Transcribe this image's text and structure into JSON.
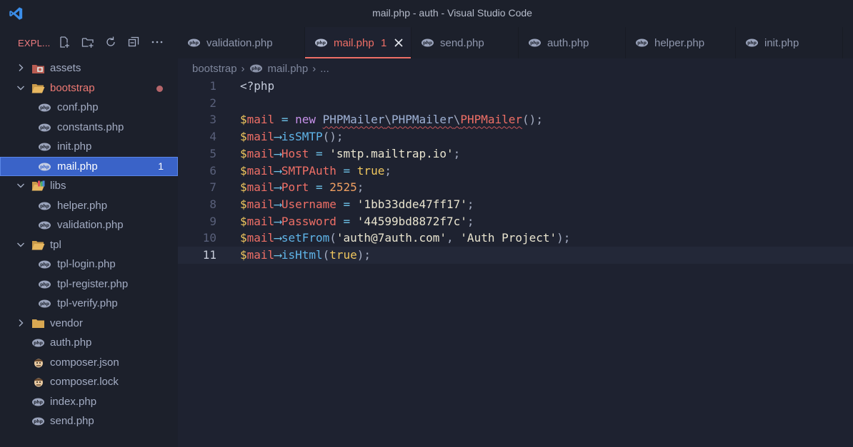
{
  "window": {
    "title": "mail.php - auth - Visual Studio Code"
  },
  "sidebar": {
    "title": "EXPL...",
    "header_icons": [
      "new-file-icon",
      "new-folder-icon",
      "refresh-icon",
      "collapse-all-icon",
      "more-icon"
    ],
    "items": [
      {
        "label": "assets",
        "type": "folder",
        "expanded": false,
        "icon": "assets-folder-icon"
      },
      {
        "label": "bootstrap",
        "type": "folder",
        "expanded": true,
        "modified": true,
        "icon": "folder-open-icon"
      },
      {
        "label": "conf.php",
        "type": "file",
        "icon": "php-icon"
      },
      {
        "label": "constants.php",
        "type": "file",
        "icon": "php-icon"
      },
      {
        "label": "init.php",
        "type": "file",
        "icon": "php-icon"
      },
      {
        "label": "mail.php",
        "type": "file",
        "icon": "php-icon",
        "selected": true,
        "badge": "1"
      },
      {
        "label": "libs",
        "type": "folder",
        "expanded": true,
        "icon": "libs-folder-icon"
      },
      {
        "label": "helper.php",
        "type": "file",
        "icon": "php-icon"
      },
      {
        "label": "validation.php",
        "type": "file",
        "icon": "php-icon"
      },
      {
        "label": "tpl",
        "type": "folder",
        "expanded": true,
        "icon": "folder-open-icon"
      },
      {
        "label": "tpl-login.php",
        "type": "file",
        "icon": "php-icon"
      },
      {
        "label": "tpl-register.php",
        "type": "file",
        "icon": "php-icon"
      },
      {
        "label": "tpl-verify.php",
        "type": "file",
        "icon": "php-icon"
      },
      {
        "label": "vendor",
        "type": "folder",
        "expanded": false,
        "icon": "folder-icon"
      },
      {
        "label": "auth.php",
        "type": "file",
        "icon": "php-icon"
      },
      {
        "label": "composer.json",
        "type": "file",
        "icon": "composer-icon"
      },
      {
        "label": "composer.lock",
        "type": "file",
        "icon": "composer-icon"
      },
      {
        "label": "index.php",
        "type": "file",
        "icon": "php-icon"
      },
      {
        "label": "send.php",
        "type": "file",
        "icon": "php-icon"
      }
    ]
  },
  "tabs": [
    {
      "label": "validation.php",
      "active": false
    },
    {
      "label": "mail.php",
      "active": true,
      "count": "1"
    },
    {
      "label": "send.php",
      "active": false
    },
    {
      "label": "auth.php",
      "active": false
    },
    {
      "label": "helper.php",
      "active": false
    },
    {
      "label": "init.php",
      "active": false
    }
  ],
  "breadcrumb": {
    "folder": "bootstrap",
    "file": "mail.php",
    "more": "..."
  },
  "code": {
    "current_line": 11,
    "lines": [
      "<?php",
      "",
      "$mail = new PHPMailer\\PHPMailer\\PHPMailer();",
      "$mail->isSMTP();",
      "$mail->Host = 'smtp.mailtrap.io';",
      "$mail->SMTPAuth = true;",
      "$mail->Port = 2525;",
      "$mail->Username = '1bb33dde47ff17';",
      "$mail->Password = '44599bd8872f7c';",
      "$mail->setFrom('auth@7auth.com', 'Auth Project');",
      "$mail->isHtml(true);"
    ]
  },
  "colors": {
    "accent": "#ef6f66",
    "selection": "#3a63c8",
    "background": "#1e2230",
    "sidebar": "#1c202b"
  }
}
